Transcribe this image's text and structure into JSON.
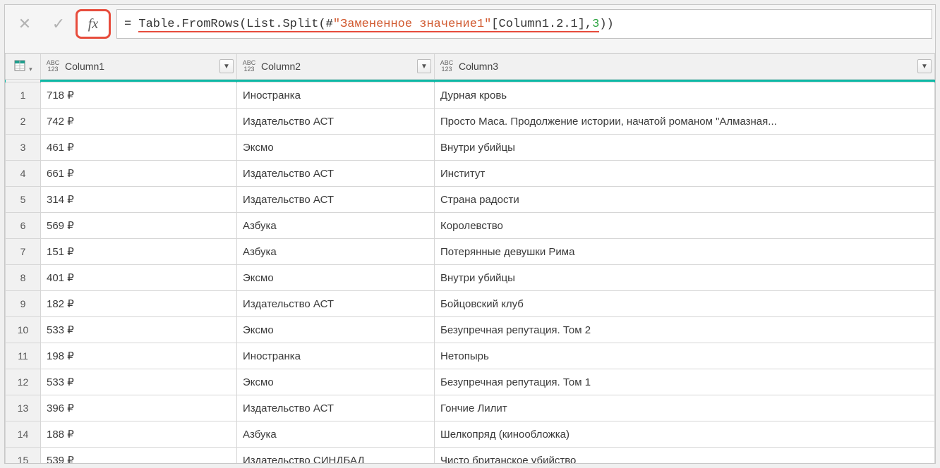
{
  "formula_bar": {
    "cancel_glyph": "✕",
    "confirm_glyph": "✓",
    "fx_label": "fx",
    "formula": {
      "prefix": "= ",
      "part1": "Table.FromRows(List.Split(#",
      "string": "\"Замененное значение1\"",
      "field": "[Column1.2.1]",
      "comma": ",",
      "number": "3",
      "suffix": "))"
    }
  },
  "columns": {
    "c1": "Column1",
    "c2": "Column2",
    "c3": "Column3",
    "type_l1": "ABC",
    "type_l2": "123"
  },
  "rows": [
    {
      "n": "1",
      "c1": "718 ₽",
      "c2": "Иностранка",
      "c3": "Дурная кровь"
    },
    {
      "n": "2",
      "c1": "742 ₽",
      "c2": "Издательство АСТ",
      "c3": "Просто Маса. Продолжение истории, начатой романом \"Алмазная..."
    },
    {
      "n": "3",
      "c1": "461 ₽",
      "c2": "Эксмо",
      "c3": "Внутри убийцы"
    },
    {
      "n": "4",
      "c1": "661 ₽",
      "c2": "Издательство АСТ",
      "c3": "Институт"
    },
    {
      "n": "5",
      "c1": "314 ₽",
      "c2": "Издательство АСТ",
      "c3": "Страна радости"
    },
    {
      "n": "6",
      "c1": "569 ₽",
      "c2": "Азбука",
      "c3": "Королевство"
    },
    {
      "n": "7",
      "c1": "151 ₽",
      "c2": "Азбука",
      "c3": "Потерянные девушки Рима"
    },
    {
      "n": "8",
      "c1": "401 ₽",
      "c2": "Эксмо",
      "c3": "Внутри убийцы"
    },
    {
      "n": "9",
      "c1": "182 ₽",
      "c2": "Издательство АСТ",
      "c3": "Бойцовский клуб"
    },
    {
      "n": "10",
      "c1": "533 ₽",
      "c2": "Эксмо",
      "c3": "Безупречная репутация. Том 2"
    },
    {
      "n": "11",
      "c1": "198 ₽",
      "c2": "Иностранка",
      "c3": "Нетопырь"
    },
    {
      "n": "12",
      "c1": "533 ₽",
      "c2": "Эксмо",
      "c3": "Безупречная репутация. Том 1"
    },
    {
      "n": "13",
      "c1": "396 ₽",
      "c2": "Издательство АСТ",
      "c3": "Гончие Лилит"
    },
    {
      "n": "14",
      "c1": "188 ₽",
      "c2": "Азбука",
      "c3": "Шелкопряд (кинообложка)"
    },
    {
      "n": "15",
      "c1": "539 ₽",
      "c2": "Издательство СИНДБАД",
      "c3": "Чисто британское убийство"
    }
  ]
}
